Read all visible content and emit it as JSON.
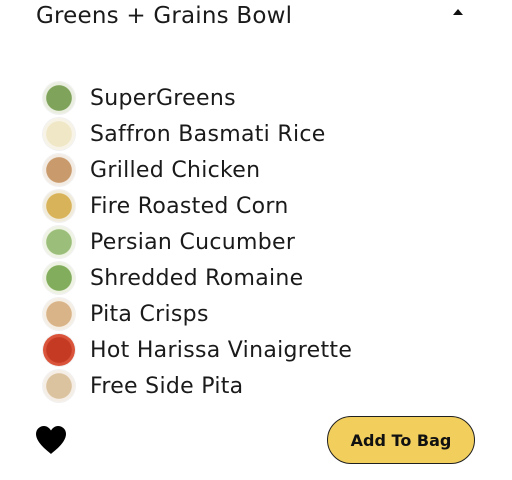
{
  "bowl": {
    "title": "Greens + Grains Bowl",
    "collapse_icon": "caret-up-icon"
  },
  "ingredients": [
    {
      "name": "SuperGreens",
      "thumb_color": "#7fa35a",
      "thumb_accent": "#e9eee0"
    },
    {
      "name": "Saffron Basmati Rice",
      "thumb_color": "#efe7c6",
      "thumb_accent": "#f7f3e6"
    },
    {
      "name": "Grilled Chicken",
      "thumb_color": "#c99a6b",
      "thumb_accent": "#f3ece4"
    },
    {
      "name": "Fire Roasted Corn",
      "thumb_color": "#d8b35a",
      "thumb_accent": "#f1ebdc"
    },
    {
      "name": "Persian Cucumber",
      "thumb_color": "#9bbf7a",
      "thumb_accent": "#eef3e4"
    },
    {
      "name": "Shredded Romaine",
      "thumb_color": "#82ad5c",
      "thumb_accent": "#edf2e3"
    },
    {
      "name": "Pita Crisps",
      "thumb_color": "#d9b489",
      "thumb_accent": "#f5eee4"
    },
    {
      "name": "Hot Harissa Vinaigrette",
      "thumb_color": "#c43a22",
      "thumb_accent": "#d9543a"
    },
    {
      "name": "Free Side Pita",
      "thumb_color": "#dcc3a0",
      "thumb_accent": "#f4eee6"
    }
  ],
  "actions": {
    "favorite_icon": "heart-icon",
    "add_to_bag_label": "Add To Bag"
  },
  "colors": {
    "button_bg": "#f2cf5c",
    "text": "#1a1a1a"
  }
}
